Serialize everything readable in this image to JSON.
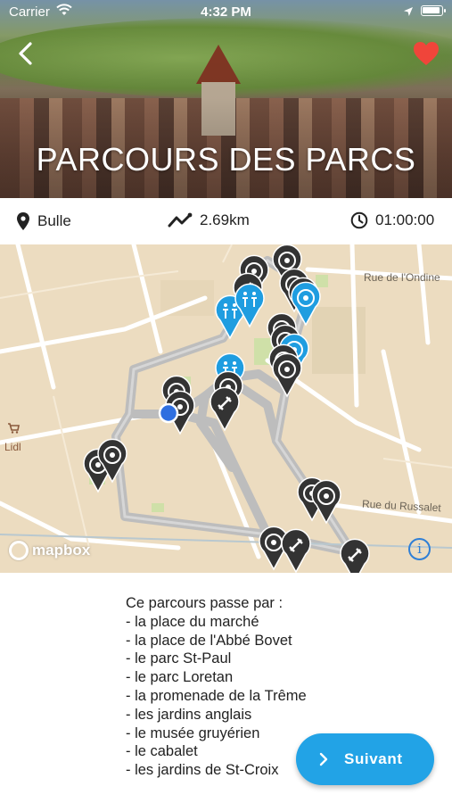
{
  "status_bar": {
    "carrier": "Carrier",
    "time": "4:32 PM",
    "icons": [
      "wifi-icon",
      "location-arrow-icon",
      "battery-icon"
    ]
  },
  "header": {
    "title": "PARCOURS DES PARCS",
    "back_icon": "chevron-left-icon",
    "favorite_icon": "heart-icon",
    "favorite_color": "#f0453a"
  },
  "info": {
    "city": "Bulle",
    "distance": "2.69km",
    "duration": "01:00:00",
    "icons": [
      "location-pin-icon",
      "route-icon",
      "clock-icon"
    ]
  },
  "map": {
    "streets": [
      "Rue de l'Ondine",
      "Rue du Russalet"
    ],
    "poi": "Lidl",
    "attribution": "mapbox",
    "colors": {
      "background": "#ecdcc0",
      "route": "#bdbdbd",
      "marker": "#333333",
      "marker_highlight": "#1f9de0",
      "user_location": "#2f6fe0"
    }
  },
  "description": {
    "intro": "Ce parcours passe par :",
    "stops": [
      "- la place du marché",
      "- la place de l'Abbé Bovet",
      "- le parc St-Paul",
      "- le parc Loretan",
      "- la promenade de la Trême",
      "- les jardins anglais",
      "- le musée gruyérien",
      "- le cabalet",
      "- les jardins de St-Croix"
    ]
  },
  "actions": {
    "next_label": "Suivant",
    "next_color": "#22a3e6"
  }
}
